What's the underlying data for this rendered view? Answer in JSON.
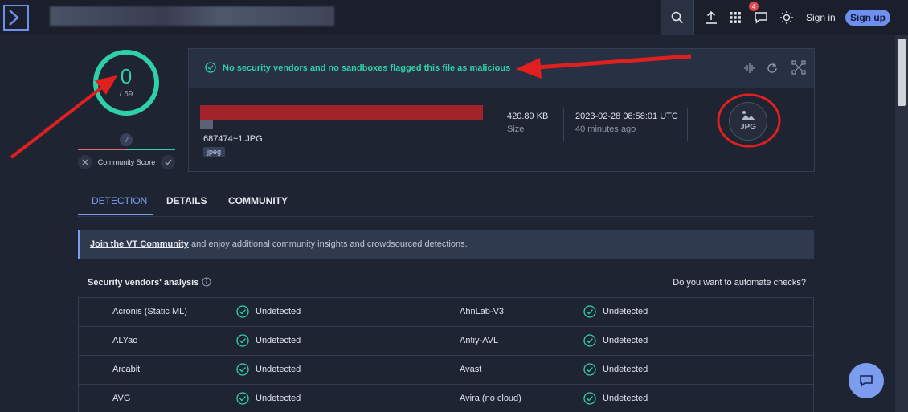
{
  "topbar": {
    "signin_label": "Sign in",
    "signup_label": "Sign up",
    "notification_count": "4",
    "icons": [
      "search-icon",
      "upload-icon",
      "apps-grid-icon",
      "chat-icon",
      "theme-sun-icon"
    ]
  },
  "score": {
    "detections": "0",
    "total": "/ 59",
    "help": "?",
    "community_label": "Community Score"
  },
  "summary": {
    "message": "No security vendors and no sandboxes flagged this file as malicious",
    "filename": "687474~1.JPG",
    "tag": "jpeg",
    "size_value": "420.89 KB",
    "size_label": "Size",
    "date_value": "2023-02-28 08:58:01 UTC",
    "date_relative": "40 minutes ago",
    "file_type_badge": "JPG"
  },
  "tabs": [
    {
      "label": "DETECTION",
      "active": true
    },
    {
      "label": "DETAILS"
    },
    {
      "label": "COMMUNITY"
    }
  ],
  "banner": {
    "link": "Join the VT Community",
    "text": "and enjoy additional community insights and crowdsourced detections."
  },
  "section": {
    "title": "Security vendors' analysis",
    "right": "Do you want to automate checks?"
  },
  "vendors": [
    {
      "left_name": "Acronis (Static ML)",
      "left_result": "Undetected",
      "right_name": "AhnLab-V3",
      "right_result": "Undetected"
    },
    {
      "left_name": "ALYac",
      "left_result": "Undetected",
      "right_name": "Antiy-AVL",
      "right_result": "Undetected"
    },
    {
      "left_name": "Arcabit",
      "left_result": "Undetected",
      "right_name": "Avast",
      "right_result": "Undetected"
    },
    {
      "left_name": "AVG",
      "left_result": "Undetected",
      "right_name": "Avira (no cloud)",
      "right_result": "Undetected"
    }
  ],
  "colors": {
    "accent": "#7c9cf0",
    "clean": "#2fd0a8",
    "annotation": "#e01f1f"
  }
}
